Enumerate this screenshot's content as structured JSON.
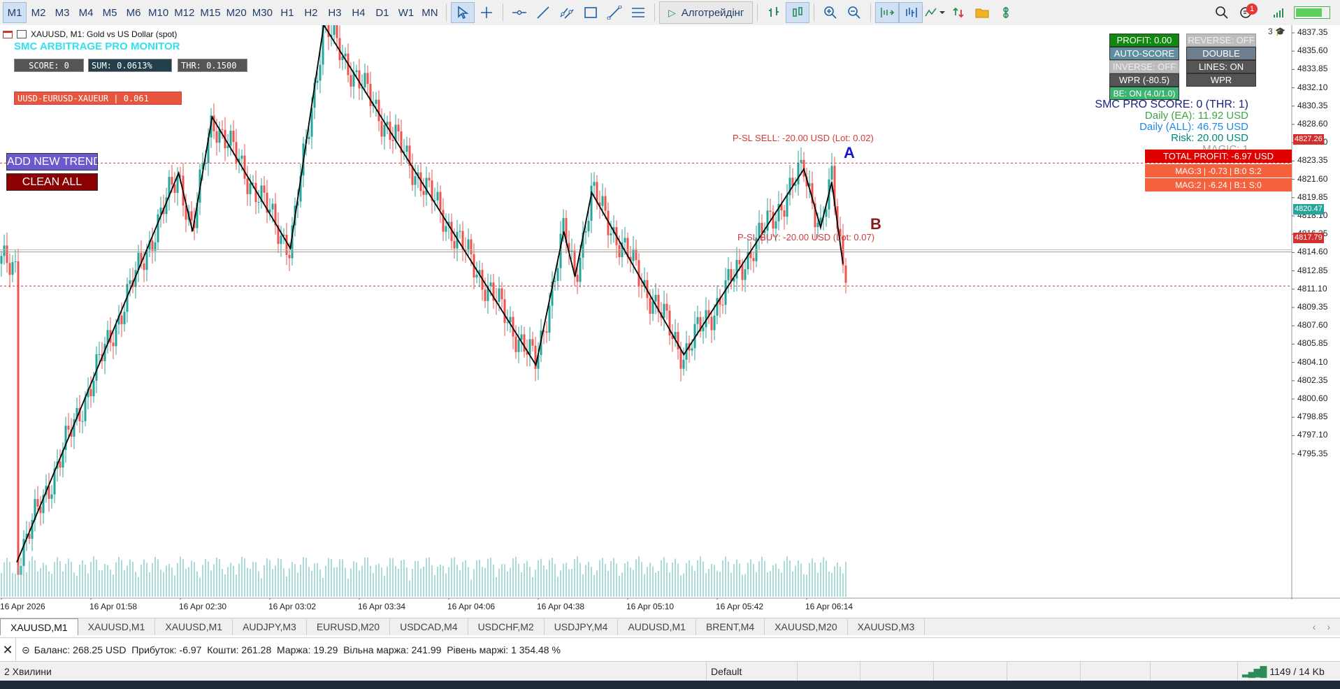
{
  "toolbar": {
    "timeframes": [
      {
        "label": "M1",
        "active": true
      },
      {
        "label": "M2",
        "active": false
      },
      {
        "label": "M3",
        "active": false
      },
      {
        "label": "M4",
        "active": false
      },
      {
        "label": "M5",
        "active": false
      },
      {
        "label": "M6",
        "active": false
      },
      {
        "label": "M10",
        "active": false
      },
      {
        "label": "M12",
        "active": false
      },
      {
        "label": "M15",
        "active": false
      },
      {
        "label": "M20",
        "active": false
      },
      {
        "label": "M30",
        "active": false
      },
      {
        "label": "H1",
        "active": false
      },
      {
        "label": "H2",
        "active": false
      },
      {
        "label": "H3",
        "active": false
      },
      {
        "label": "H4",
        "active": false
      },
      {
        "label": "D1",
        "active": false
      },
      {
        "label": "W1",
        "active": false
      },
      {
        "label": "MN",
        "active": false
      }
    ],
    "algo_label": "Алготрейдінг",
    "notification_count": "1",
    "accent": "#1f3d6b"
  },
  "chart": {
    "symbol_header": "XAUUSD, M1:  Gold vs US Dollar (spot)",
    "corner_number": "3",
    "ea_title": "SMC ARBITRAGE PRO MONITOR",
    "score_box": "SCORE: 0",
    "sum_box": "SUM: 0.0613%",
    "thr_box": "THR: 0.1500",
    "pair_box": "UUSD-EURUSD-XAUEUR | 0.061",
    "add_trend_label": "ADD NEW TREND",
    "clean_all_label": "CLEAN ALL",
    "panel_buttons": {
      "profit": "PROFIT: 0.00",
      "reverse": "REVERSE: OFF",
      "auto_score": "AUTO-SCORE",
      "double": "DOUBLE",
      "inverse": "INVERSE: OFF",
      "lines": "LINES: ON",
      "wpr_value": "WPR (-80.5)",
      "wpr": "WPR",
      "be": "BE: ON (4.0/1.0)"
    },
    "info_lines": {
      "score": "SMC PRO SCORE: 0 (THR: 1)",
      "daily_ea": "Daily (EA): 11.92 USD",
      "daily_all": "Daily (ALL): 46.75 USD",
      "risk": "Risk: 20.00 USD",
      "magic": "MAGIC: 1"
    },
    "total_profit": "TOTAL PROFIT: -6.97 USD",
    "mag_rows": [
      "MAG:3 | -0.73 | B:0 S:2",
      "MAG:2 | -6.24 | B:1 S:0"
    ],
    "sl_sell_label": "P-SL SELL: -20.00 USD (Lot: 0.02)",
    "sl_buy_label": "P-SL BUY: -20.00 USD (Lot: 0.07)",
    "label_a": "A",
    "label_b": "B",
    "price_tags": {
      "sell": "4827.26",
      "current": "4820.47",
      "buy": "4817.79"
    },
    "price_axis": [
      "4837.35",
      "4835.60",
      "4833.85",
      "4832.10",
      "4830.35",
      "4828.60",
      "4825.10",
      "4823.35",
      "4821.60",
      "4819.85",
      "4818.10",
      "4816.35",
      "4814.60",
      "4812.85",
      "4811.10",
      "4809.35",
      "4807.60",
      "4805.85",
      "4804.10",
      "4802.35",
      "4800.60",
      "4798.85",
      "4797.10",
      "4795.35"
    ],
    "time_axis": [
      "16 Apr 2026",
      "16 Apr 01:58",
      "16 Apr 02:30",
      "16 Apr 03:02",
      "16 Apr 03:34",
      "16 Apr 04:06",
      "16 Apr 04:38",
      "16 Apr 05:10",
      "16 Apr 05:42",
      "16 Apr 06:14"
    ],
    "colors": {
      "bull": "#26a69a",
      "bear": "#ef5350",
      "sl_line": "#d23a3a",
      "current_line": "#9aa0a6"
    }
  },
  "chart_data": {
    "type": "line",
    "title": "XAUUSD, M1",
    "xlabel": "",
    "ylabel": "",
    "ylim": [
      4794.5,
      4838.0
    ],
    "zigzag": {
      "x": [
        "16 Apr 01:32",
        "16 Apr 02:30",
        "16 Apr 02:35",
        "16 Apr 02:42",
        "16 Apr 03:10",
        "16 Apr 03:22",
        "16 Apr 04:38",
        "16 Apr 04:48",
        "16 Apr 04:52",
        "16 Apr 04:58",
        "16 Apr 05:31",
        "16 Apr 06:14",
        "16 Apr 06:20",
        "16 Apr 06:24",
        "16 Apr 06:28"
      ],
      "y": [
        4796.5,
        4826.5,
        4822.0,
        4830.8,
        4820.7,
        4837.9,
        4811.7,
        4822.0,
        4818.5,
        4825.0,
        4812.5,
        4826.8,
        4822.3,
        4825.8,
        4819.5
      ]
    },
    "levels": {
      "sl_sell": 4827.26,
      "current": 4820.47,
      "sl_buy": 4817.79
    }
  },
  "tabs": [
    {
      "label": "XAUUSD,M1",
      "active": true
    },
    {
      "label": "XAUUSD,M1",
      "active": false
    },
    {
      "label": "XAUUSD,M1",
      "active": false
    },
    {
      "label": "AUDJPY,M3",
      "active": false
    },
    {
      "label": "EURUSD,M20",
      "active": false
    },
    {
      "label": "USDCAD,M4",
      "active": false
    },
    {
      "label": "USDCHF,M2",
      "active": false
    },
    {
      "label": "USDJPY,M4",
      "active": false
    },
    {
      "label": "AUDUSD,M1",
      "active": false
    },
    {
      "label": "BRENT,M4",
      "active": false
    },
    {
      "label": "XAUUSD,M20",
      "active": false
    },
    {
      "label": "XAUUSD,M3",
      "active": false
    }
  ],
  "account": {
    "text": "Баланс: 268.25 USD  Прибуток: -6.97  Кошти: 261.28  Маржа: 19.29  Вільна маржа: 241.99  Рівень маржі: 1 354.48 %"
  },
  "status": {
    "left": "2 Хвилини",
    "profile": "Default",
    "traffic": "1149 / 14 Kb"
  }
}
